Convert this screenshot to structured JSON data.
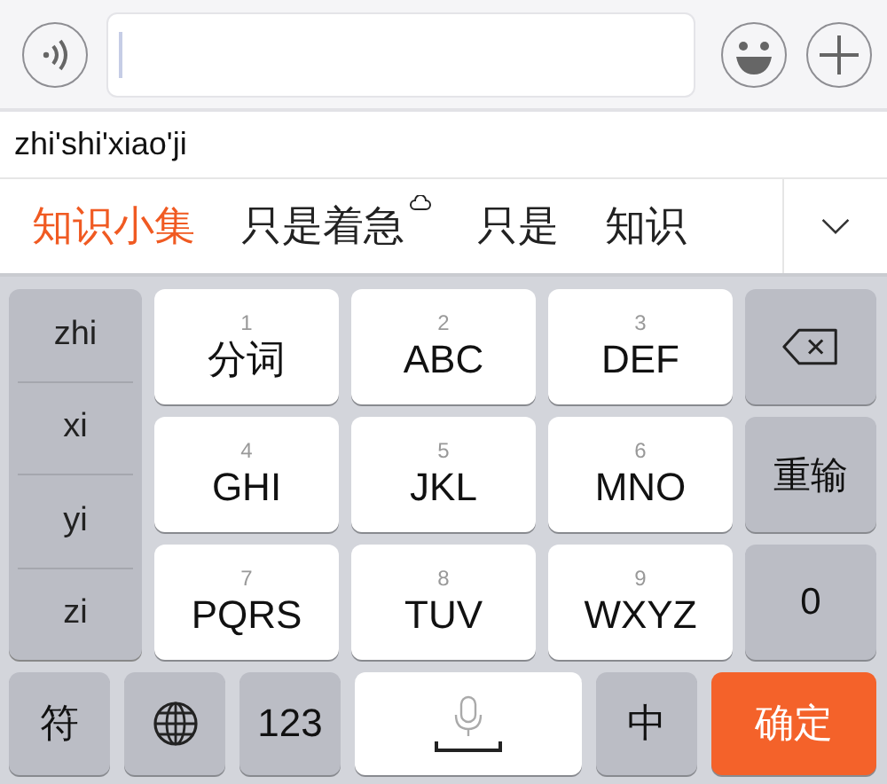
{
  "pinyin": "zhi'shi'xiao'ji",
  "candidates": [
    {
      "text": "知识小集",
      "selected": true,
      "cloud": false
    },
    {
      "text": "只是着急",
      "selected": false,
      "cloud": true
    },
    {
      "text": "只是",
      "selected": false,
      "cloud": false
    },
    {
      "text": "知识",
      "selected": false,
      "cloud": false
    }
  ],
  "syllables": [
    "zhi",
    "xi",
    "yi",
    "zi"
  ],
  "keys": [
    {
      "number": "1",
      "label": "分词"
    },
    {
      "number": "2",
      "label": "ABC"
    },
    {
      "number": "3",
      "label": "DEF"
    },
    {
      "number": "4",
      "label": "GHI"
    },
    {
      "number": "5",
      "label": "JKL"
    },
    {
      "number": "6",
      "label": "MNO"
    },
    {
      "number": "7",
      "label": "PQRS"
    },
    {
      "number": "8",
      "label": "TUV"
    },
    {
      "number": "9",
      "label": "WXYZ"
    }
  ],
  "side_keys": [
    {
      "kind": "delete"
    },
    {
      "kind": "text",
      "label": "重输"
    },
    {
      "kind": "text",
      "label": "0"
    }
  ],
  "bottom_keys": [
    {
      "kind": "text",
      "label": "符"
    },
    {
      "kind": "globe"
    },
    {
      "kind": "text",
      "label": "123"
    },
    {
      "kind": "space"
    },
    {
      "kind": "text",
      "label": "中"
    },
    {
      "kind": "confirm",
      "label": "确定"
    }
  ]
}
